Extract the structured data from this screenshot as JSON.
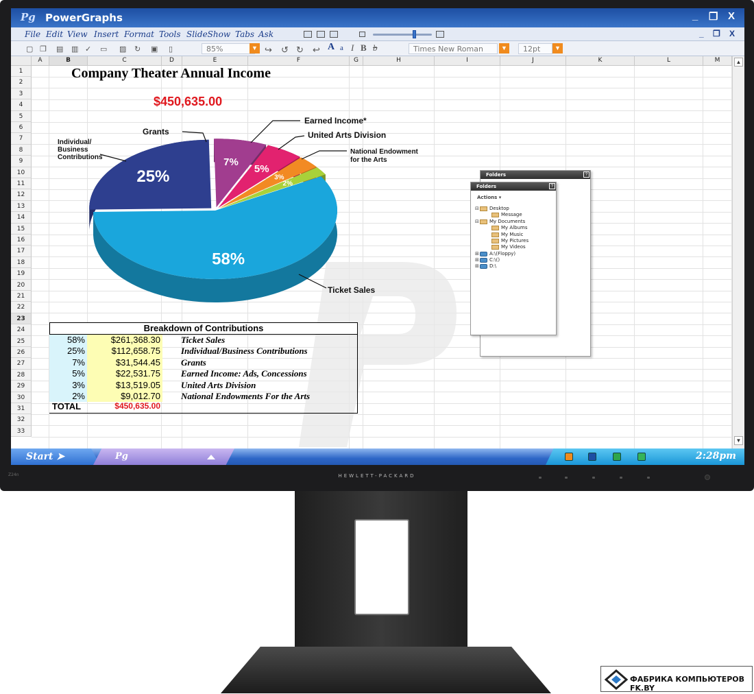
{
  "window": {
    "logo": "Pg",
    "title": "PowerGraphs",
    "minimize": "_",
    "restore": "❐",
    "close": "X"
  },
  "menu": [
    "File",
    "Edit",
    "View",
    "Insert",
    "Format",
    "Tools",
    "SlideShow",
    "Tabs",
    "Ask"
  ],
  "toolbar": {
    "zoom": "85%",
    "font": "Times New Roman",
    "size": "12pt",
    "bold": "B",
    "italic": "I",
    "font_a": "A",
    "font_a_small": "a"
  },
  "columns": [
    "A",
    "B",
    "C",
    "D",
    "E",
    "F",
    "G",
    "H",
    "I",
    "J",
    "K",
    "L",
    "M"
  ],
  "rows": [
    "1",
    "2",
    "3",
    "4",
    "5",
    "6",
    "7",
    "8",
    "9",
    "10",
    "11",
    "12",
    "13",
    "14",
    "15",
    "16",
    "17",
    "18",
    "19",
    "20",
    "21",
    "22",
    "23",
    "24",
    "25",
    "26",
    "27",
    "28",
    "29",
    "30",
    "31",
    "32",
    "33"
  ],
  "sheet": {
    "title": "Company Theater Annual Income",
    "total_display": "$450,635.00"
  },
  "chart_data": {
    "type": "pie",
    "slices": [
      {
        "label": "Ticket Sales",
        "value": 58,
        "display": "58%",
        "color": "#1aa6dc"
      },
      {
        "label": "Individual/ Business Contributions",
        "value": 25,
        "display": "25%",
        "color": "#2e3f8f"
      },
      {
        "label": "Grants",
        "value": 7,
        "display": "7%",
        "color": "#a13d8f"
      },
      {
        "label": "Earned Income*",
        "value": 5,
        "display": "5%",
        "color": "#e2226f"
      },
      {
        "label": "United Arts Division",
        "value": 3,
        "display": "3%",
        "color": "#f28a23"
      },
      {
        "label": "National Endowment for the Arts",
        "value": 2,
        "display": "2%",
        "color": "#a9d13a"
      }
    ],
    "callouts": {
      "ticket": "Ticket Sales",
      "individual_1": "Individual/",
      "individual_2": "Business",
      "individual_3": "Contributions",
      "grants": "Grants",
      "earned": "Earned Income*",
      "united": "United Arts Division",
      "nea_1": "National Endowment",
      "nea_2": "for the Arts"
    }
  },
  "table": {
    "title": "Breakdown of Contributions",
    "rows": [
      {
        "pct": "58%",
        "amount": "$261,368.30",
        "desc": "Ticket Sales"
      },
      {
        "pct": "25%",
        "amount": "$112,658.75",
        "desc": "Individual/Business Contributions"
      },
      {
        "pct": "7%",
        "amount": "$31,544.45",
        "desc": "Grants"
      },
      {
        "pct": "5%",
        "amount": "$22,531.75",
        "desc": "Earned Income: Ads, Concessions"
      },
      {
        "pct": "3%",
        "amount": "$13,519.05",
        "desc": "United Arts Division"
      },
      {
        "pct": "2%",
        "amount": "$9,012.70",
        "desc": "National Endowments For the Arts"
      }
    ],
    "total_label": "TOTAL",
    "total_value": "$450,635.00"
  },
  "folders_back": {
    "title": "Folders",
    "help": "?"
  },
  "folders": {
    "title": "Folders",
    "help": "?",
    "actions": "Actions",
    "items": [
      "Desktop",
      "Message",
      "My Documents",
      "My Albums",
      "My Music",
      "My Pictures",
      "My Videos",
      "A:\\(Floppy)",
      "C:\\()",
      "D:\\"
    ]
  },
  "taskbar": {
    "start": "Start",
    "task": "Pg",
    "clock": "2:28pm"
  },
  "monitor": {
    "brand": "HEWLETT-PACKARD",
    "model": "Z24n"
  },
  "badge": {
    "text": "ФАБРИКА КОМПЬЮТЕРОВ FK.BY"
  },
  "colors": {
    "accent": "#1d4fa3",
    "total_red": "#e0181e",
    "orange": "#f08b1e"
  }
}
